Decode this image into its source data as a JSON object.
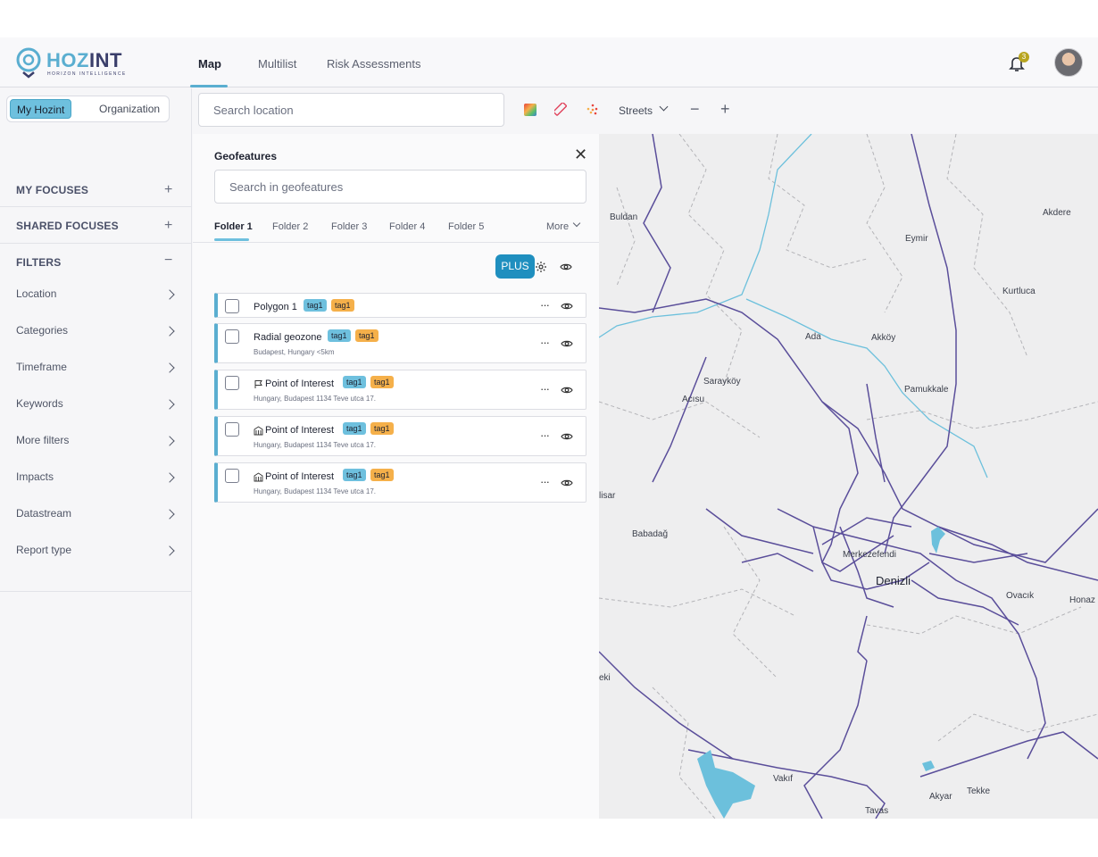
{
  "brand": {
    "name_a": "HOZ",
    "name_b": "INT",
    "tagline": "HORIZON INTELLIGENCE"
  },
  "nav": {
    "tabs": [
      {
        "label": "Map"
      },
      {
        "label": "Multilist"
      },
      {
        "label": "Risk Assessments"
      }
    ]
  },
  "notifications": {
    "count": "3"
  },
  "sidebar": {
    "scope": {
      "active": "My Hozint",
      "inactive": "Organization"
    },
    "sections": {
      "my_focuses": "MY FOCUSES",
      "shared_focuses": "SHARED FOCUSES",
      "filters": "FILTERS"
    },
    "filters": [
      "Location",
      "Categories",
      "Timeframe",
      "Keywords",
      "More filters",
      "Impacts",
      "Datastream",
      "Report type"
    ]
  },
  "toolbar": {
    "search_placeholder": "Search location",
    "basemap": "Streets",
    "zoom_out": "−",
    "zoom_in": "+"
  },
  "geofeatures": {
    "title": "Geofeatures",
    "close": "✕",
    "search_placeholder": "Search in geofeatures",
    "folders": [
      "Folder 1",
      "Folder 2",
      "Folder 3",
      "Folder 4",
      "Folder 5"
    ],
    "more": "More",
    "plus_label": "PLUS",
    "items": [
      {
        "name": "Polygon 1",
        "icon": "none",
        "tags": [
          "tag1",
          "tag1"
        ],
        "sub": ""
      },
      {
        "name": "Radial geozone",
        "icon": "none",
        "tags": [
          "tag1",
          "tag1"
        ],
        "sub": "Budapest, Hungary <5km"
      },
      {
        "name": "Point of Interest",
        "icon": "flag-icon",
        "tags": [
          "tag1",
          "tag1"
        ],
        "sub": "Hungary, Budapest 1134 Teve utca 17."
      },
      {
        "name": "Point of Interest",
        "icon": "building-icon",
        "tags": [
          "tag1",
          "tag1"
        ],
        "sub": "Hungary, Budapest 1134 Teve utca 17."
      },
      {
        "name": "Point of Interest",
        "icon": "building-icon",
        "tags": [
          "tag1",
          "tag1"
        ],
        "sub": "Hungary, Budapest 1134 Teve utca 17."
      }
    ]
  },
  "map": {
    "places": [
      "Buldan",
      "Akdere",
      "Eymir",
      "Kurtluca",
      "Ada",
      "Akköy",
      "Sarayköy",
      "Pamukkale",
      "Acısu",
      "lisar",
      "Babadağ",
      "Merkezefendi",
      "Denizli",
      "Ovacık",
      "Honaz",
      "eki",
      "Vakıf",
      "Akyar",
      "Tekke",
      "Tavas"
    ],
    "colors": {
      "road": "#5a4e9a",
      "river": "#6cc0dc",
      "border": "#b4b4b8",
      "background": "#eeeeef"
    }
  },
  "colors": {
    "accent": "#5aaed0",
    "primary_button": "#1f8fbf",
    "tag_blue": "#6ec0de",
    "tag_orange": "#f5b04a"
  }
}
